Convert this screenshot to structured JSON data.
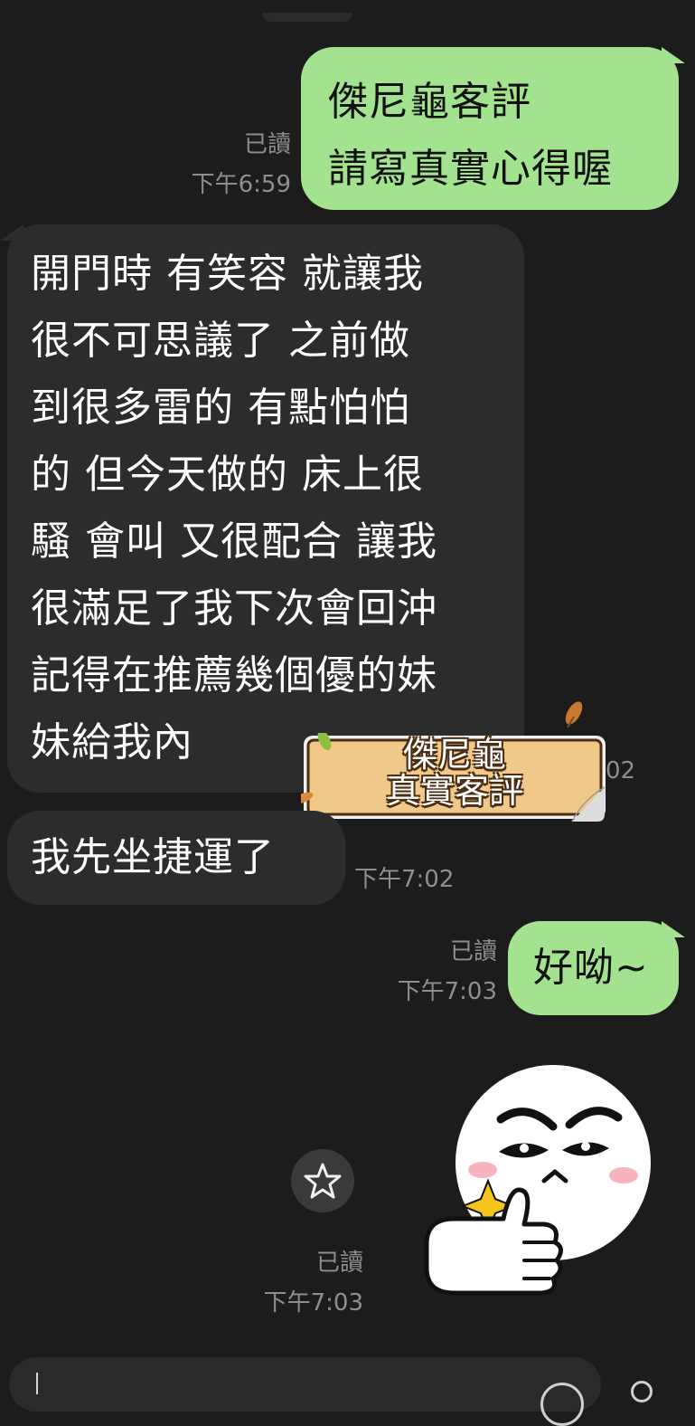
{
  "messages": [
    {
      "dir": "out",
      "lines": [
        "傑尼龜客評",
        "請寫真實心得喔"
      ],
      "read": "已讀",
      "time": "下午6:59"
    },
    {
      "dir": "in",
      "lines": [
        "開門時 有笑容 就讓我",
        "很不可思議了 之前做",
        "到很多雷的 有點怕怕",
        "的 但今天做的 床上很",
        "騷 會叫 又很配合 讓我",
        "很滿足了我下次會回沖",
        "記得在推薦幾個優的妹",
        "妹給我內"
      ],
      "time_partial": "02"
    },
    {
      "dir": "in",
      "lines": [
        "我先坐捷運了"
      ],
      "time": "下午7:02"
    },
    {
      "dir": "out",
      "lines": [
        "好呦~"
      ],
      "read": "已讀",
      "time": "下午7:03"
    },
    {
      "dir": "out",
      "type": "sticker",
      "sticker": "moon-thumbs-up-sticker",
      "read": "已讀",
      "time": "下午7:03"
    }
  ],
  "label_sticker": {
    "lines": [
      "傑尼龜",
      "真實客評"
    ]
  },
  "icons": {
    "star": "star-icon",
    "emoji": "emoji-icon",
    "mic": "mic-icon"
  },
  "colors": {
    "background": "#1c1c1c",
    "outgoing": "#a3e28f",
    "incoming": "#2c2c2c",
    "meta": "#8e8e8e"
  }
}
